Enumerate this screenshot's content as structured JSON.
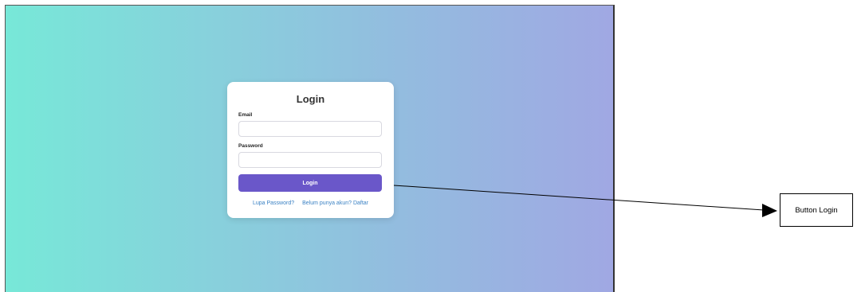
{
  "login_form": {
    "title": "Login",
    "email_label": "Email",
    "email_value": "",
    "email_placeholder": "",
    "password_label": "Password",
    "password_value": "",
    "password_placeholder": "",
    "submit_label": "Login",
    "forgot_password_link": "Lupa Password?",
    "register_link": "Belum punya akun? Daftar"
  },
  "annotation": {
    "label": "Button Login"
  },
  "colors": {
    "gradient_start": "#77e8d8",
    "gradient_end": "#a0a8e3",
    "button": "#6a57c9",
    "link": "#3b82c4"
  }
}
